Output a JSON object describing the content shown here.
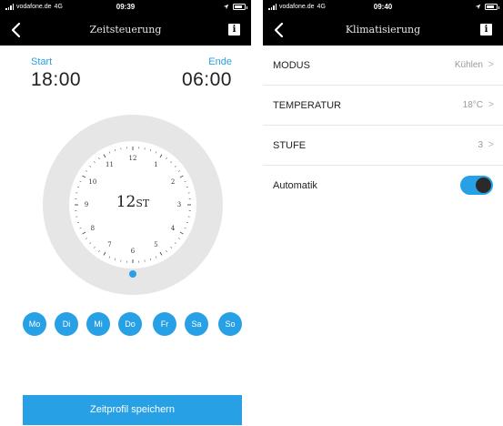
{
  "left": {
    "status": {
      "carrier": "vodafone.de",
      "network": "4G",
      "time": "09:39"
    },
    "nav": {
      "title": "Zeitsteuerung",
      "info": "i"
    },
    "start": {
      "label": "Start",
      "time": "18:00"
    },
    "end": {
      "label": "Ende",
      "time": "06:00"
    },
    "clock": {
      "duration_number": "12",
      "duration_unit": "ST",
      "hours": [
        "12",
        "1",
        "2",
        "3",
        "4",
        "5",
        "6",
        "7",
        "8",
        "9",
        "10",
        "11"
      ]
    },
    "days": [
      "Mo",
      "Di",
      "Mi",
      "Do",
      "Fr",
      "Sa",
      "So"
    ],
    "save_button": "Zeitprofil speichern"
  },
  "right": {
    "status": {
      "carrier": "vodafone.de",
      "network": "4G",
      "time": "09:40"
    },
    "nav": {
      "title": "Klimatisierung",
      "info": "i"
    },
    "rows": [
      {
        "label": "MODUS",
        "value": "Kühlen"
      },
      {
        "label": "TEMPERATUR",
        "value": "18°C"
      },
      {
        "label": "STUFE",
        "value": "3"
      }
    ],
    "automatik": {
      "label": "Automatik",
      "on": true
    }
  },
  "colors": {
    "accent": "#27a0e6",
    "ring": "#e6e6e6",
    "bar": "#000000"
  },
  "icons": {
    "back": "chevron-left-icon",
    "info": "info-icon",
    "chevron": "chevron-right-icon"
  }
}
